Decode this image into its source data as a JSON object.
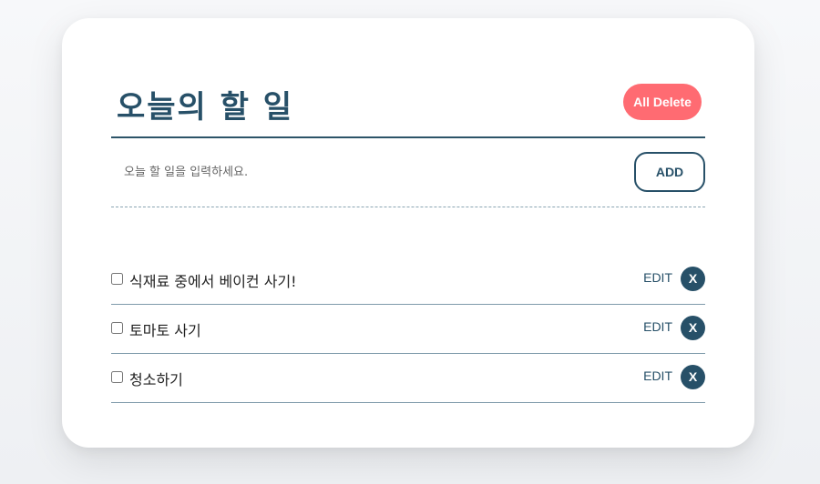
{
  "header": {
    "title": "오늘의 할 일",
    "all_delete_label": "All Delete"
  },
  "input": {
    "placeholder": "오늘 할 일을 입력하세요.",
    "value": "",
    "add_label": "ADD"
  },
  "todos": [
    {
      "text": "식재료 중에서 베이컨 사기!",
      "checked": false,
      "edit_label": "EDIT",
      "delete_label": "X"
    },
    {
      "text": "토마토 사기",
      "checked": false,
      "edit_label": "EDIT",
      "delete_label": "X"
    },
    {
      "text": "청소하기",
      "checked": false,
      "edit_label": "EDIT",
      "delete_label": "X"
    }
  ],
  "colors": {
    "primary": "#275068",
    "danger": "#ff6b72",
    "card_bg": "#ffffff"
  }
}
